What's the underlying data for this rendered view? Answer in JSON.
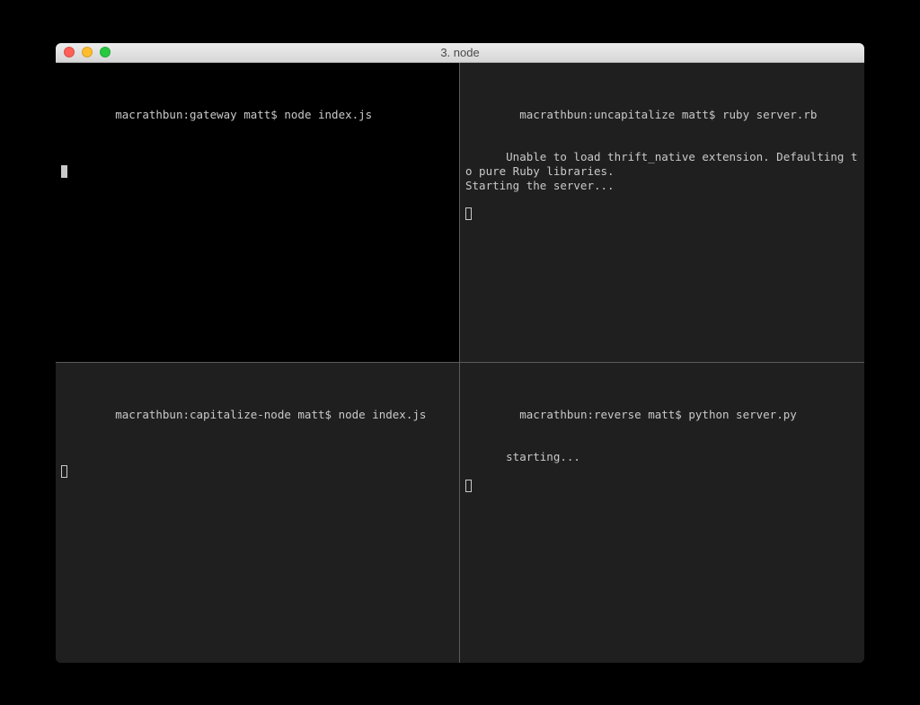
{
  "window": {
    "title": "3. node"
  },
  "panes": {
    "top_left": {
      "prompt": "macrathbun:gateway matt$ ",
      "command": "node index.js",
      "output": ""
    },
    "top_right": {
      "prompt": "macrathbun:uncapitalize matt$ ",
      "command": "ruby server.rb",
      "output": "Unable to load thrift_native extension. Defaulting to pure Ruby libraries.\nStarting the server..."
    },
    "bottom_left": {
      "prompt": "macrathbun:capitalize-node matt$ ",
      "command": "node index.js",
      "output": ""
    },
    "bottom_right": {
      "prompt": "macrathbun:reverse matt$ ",
      "command": "python server.py",
      "output": "starting..."
    }
  }
}
